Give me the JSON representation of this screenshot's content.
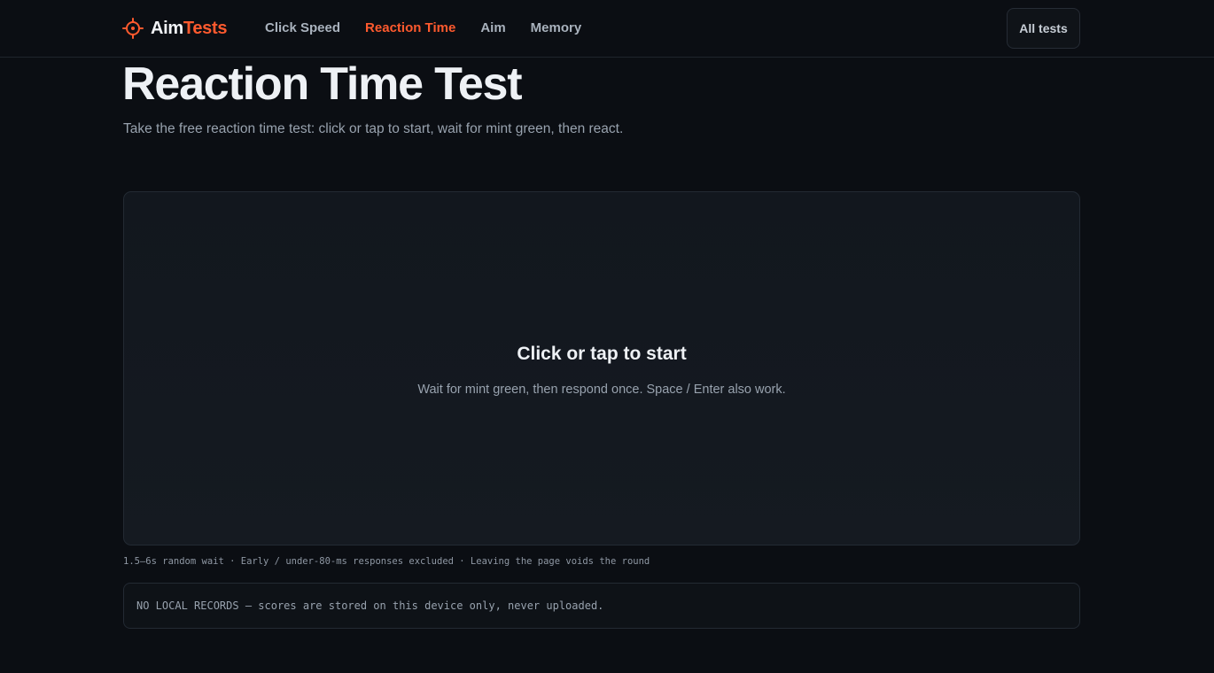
{
  "brand": {
    "name_part1": "Aim",
    "name_part2": "Tests",
    "logo_icon": "crosshair-icon",
    "accent_color": "#ff5a2e"
  },
  "nav": {
    "items": [
      {
        "label": "Click Speed",
        "active": false
      },
      {
        "label": "Reaction Time",
        "active": true
      },
      {
        "label": "Aim",
        "active": false
      },
      {
        "label": "Memory",
        "active": false
      }
    ],
    "all_tests_label": "All tests"
  },
  "page": {
    "title": "Reaction Time Test",
    "subtitle": "Take the free reaction time test: click or tap to start, wait for mint green, then react."
  },
  "test_area": {
    "prompt_title": "Click or tap to start",
    "prompt_hint": "Wait for mint green, then respond once. Space / Enter also work."
  },
  "rules_line": "1.5–6s random wait · Early / under-80-ms responses excluded · Leaving the page voids the round",
  "records": {
    "text": "NO LOCAL RECORDS — scores are stored on this device only, never uploaded."
  },
  "colors": {
    "background": "#0b0e13",
    "panel": "#141920",
    "border": "#232a33",
    "text_primary": "#eef1f5",
    "text_muted": "#98a2ae"
  }
}
